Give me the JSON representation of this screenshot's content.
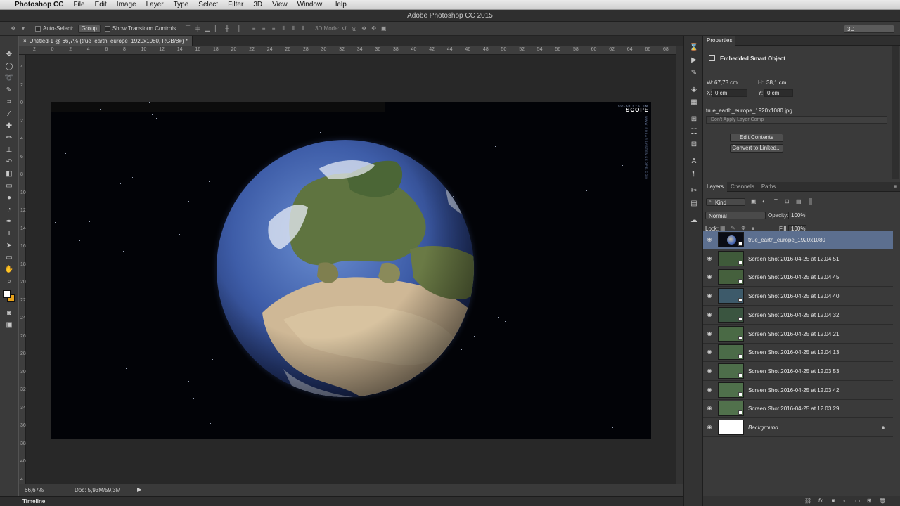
{
  "menubar": {
    "items": [
      "Photoshop CC",
      "File",
      "Edit",
      "Image",
      "Layer",
      "Type",
      "Select",
      "Filter",
      "3D",
      "View",
      "Window",
      "Help"
    ]
  },
  "window_title": "Adobe Photoshop CC 2015",
  "options": {
    "auto_select_label": "Auto-Select:",
    "auto_select_value": "Group",
    "show_transform_label": "Show Transform Controls",
    "mode_3d_label": "3D Mode:",
    "workspace_value": "3D"
  },
  "document": {
    "tab_label": "Untitled-1 @ 66,7% (true_earth_europe_1920x1080, RGB/8#) *",
    "watermark_top": "SOLAR SYSTEM",
    "watermark_logo": "SCOPE",
    "watermark_side": "WWW.SOLARSYSTEMSCOPE.COM",
    "ruler_h": [
      "2",
      "0",
      "2",
      "4",
      "6",
      "8",
      "10",
      "12",
      "14",
      "16",
      "18",
      "20",
      "22",
      "24",
      "26",
      "28",
      "30",
      "32",
      "34",
      "36",
      "38",
      "40",
      "42",
      "44",
      "46",
      "48",
      "50",
      "52",
      "54",
      "56",
      "58",
      "60",
      "62",
      "64",
      "66",
      "68",
      "7"
    ],
    "ruler_v": [
      "4",
      "2",
      "0",
      "2",
      "4",
      "6",
      "8",
      "10",
      "12",
      "14",
      "16",
      "18",
      "20",
      "22",
      "24",
      "26",
      "28",
      "30",
      "32",
      "34",
      "36",
      "38",
      "40",
      "4"
    ]
  },
  "status": {
    "zoom": "66,67%",
    "doc_size": "Doc: 5,93M/59,3M"
  },
  "timeline_label": "Timeline",
  "properties": {
    "title": "Properties",
    "object_type": "Embedded Smart Object",
    "w_label": "W:",
    "w_value": "67,73 cm",
    "h_label": "H:",
    "h_value": "38,1 cm",
    "x_label": "X:",
    "x_value": "0 cm",
    "y_label": "Y:",
    "y_value": "0 cm",
    "filename": "true_earth_europe_1920x1080.jpg",
    "layer_comp": "Don't Apply Layer Comp",
    "edit_contents": "Edit Contents",
    "convert_linked": "Convert to Linked..."
  },
  "layers_panel": {
    "tabs": [
      "Layers",
      "Channels",
      "Paths"
    ],
    "filter_kind": "Kind",
    "blend_mode": "Normal",
    "opacity_label": "Opacity:",
    "opacity_value": "100%",
    "lock_label": "Lock:",
    "fill_label": "Fill:",
    "fill_value": "100%",
    "layers": [
      {
        "name": "true_earth_europe_1920x1080",
        "selected": true
      },
      {
        "name": "Screen Shot 2016-04-25 at 12.04.51",
        "selected": false
      },
      {
        "name": "Screen Shot 2016-04-25 at 12.04.45",
        "selected": false
      },
      {
        "name": "Screen Shot 2016-04-25 at 12.04.40",
        "selected": false
      },
      {
        "name": "Screen Shot 2016-04-25 at 12.04.32",
        "selected": false
      },
      {
        "name": "Screen Shot 2016-04-25 at 12.04.21",
        "selected": false
      },
      {
        "name": "Screen Shot 2016-04-25 at 12.04.13",
        "selected": false
      },
      {
        "name": "Screen Shot 2016-04-25 at 12.03.53",
        "selected": false
      },
      {
        "name": "Screen Shot 2016-04-25 at 12.03.42",
        "selected": false
      },
      {
        "name": "Screen Shot 2016-04-25 at 12.03.29",
        "selected": false
      },
      {
        "name": "Background",
        "selected": false
      }
    ]
  },
  "colors": {
    "selection": "#5c6f8f",
    "foreground_swatch": "#ffffff",
    "background_swatch": "#e8a21b"
  }
}
